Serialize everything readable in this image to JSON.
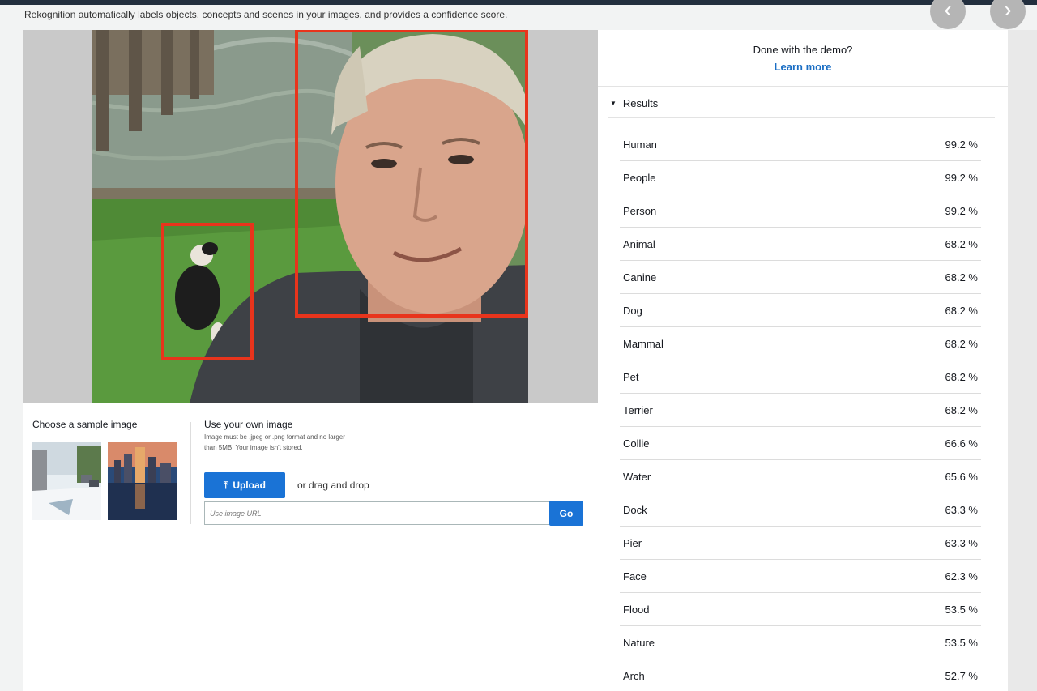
{
  "header": {
    "intro": "Rekognition automatically labels objects, concepts and scenes in your images, and provides a confidence score.",
    "prev_icon": "chevron-left-icon",
    "next_icon": "chevron-right-icon"
  },
  "samples": {
    "title": "Choose a sample image"
  },
  "own_image": {
    "title": "Use your own image",
    "note": "Image must be .jpeg or .png format and no larger than 5MB. Your image isn't stored.",
    "upload_label": "Upload",
    "drag_text": "or drag and drop",
    "url_placeholder": "Use image URL",
    "go_label": "Go"
  },
  "sidebar": {
    "done_text": "Done with the demo?",
    "learn_more": "Learn more",
    "results_label": "Results"
  },
  "results": [
    {
      "label": "Human",
      "score": "99.2 %"
    },
    {
      "label": "People",
      "score": "99.2 %"
    },
    {
      "label": "Person",
      "score": "99.2 %"
    },
    {
      "label": "Animal",
      "score": "68.2 %"
    },
    {
      "label": "Canine",
      "score": "68.2 %"
    },
    {
      "label": "Dog",
      "score": "68.2 %"
    },
    {
      "label": "Mammal",
      "score": "68.2 %"
    },
    {
      "label": "Pet",
      "score": "68.2 %"
    },
    {
      "label": "Terrier",
      "score": "68.2 %"
    },
    {
      "label": "Collie",
      "score": "66.6 %"
    },
    {
      "label": "Water",
      "score": "65.6 %"
    },
    {
      "label": "Dock",
      "score": "63.3 %"
    },
    {
      "label": "Pier",
      "score": "63.3 %"
    },
    {
      "label": "Face",
      "score": "62.3 %"
    },
    {
      "label": "Flood",
      "score": "53.5 %"
    },
    {
      "label": "Nature",
      "score": "53.5 %"
    },
    {
      "label": "Arch",
      "score": "52.7 %"
    }
  ],
  "colors": {
    "accent": "#1a73d6",
    "bbox": "#e8341c",
    "link": "#1a6ec4"
  }
}
